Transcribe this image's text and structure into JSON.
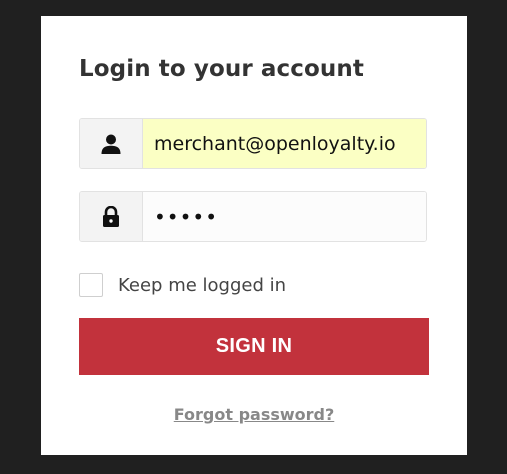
{
  "login": {
    "title": "Login to your account",
    "email": {
      "value": "merchant@openloyalty.io",
      "icon": "user-icon"
    },
    "password": {
      "value": "•••••",
      "icon": "lock-icon"
    },
    "remember_label": "Keep me logged in",
    "remember_checked": false,
    "signin_label": "SIGN IN",
    "forgot_label": "Forgot password?"
  },
  "colors": {
    "background": "#202020",
    "panel": "#ffffff",
    "primary_button": "#c2323c",
    "autofill": "#fbffc4"
  }
}
